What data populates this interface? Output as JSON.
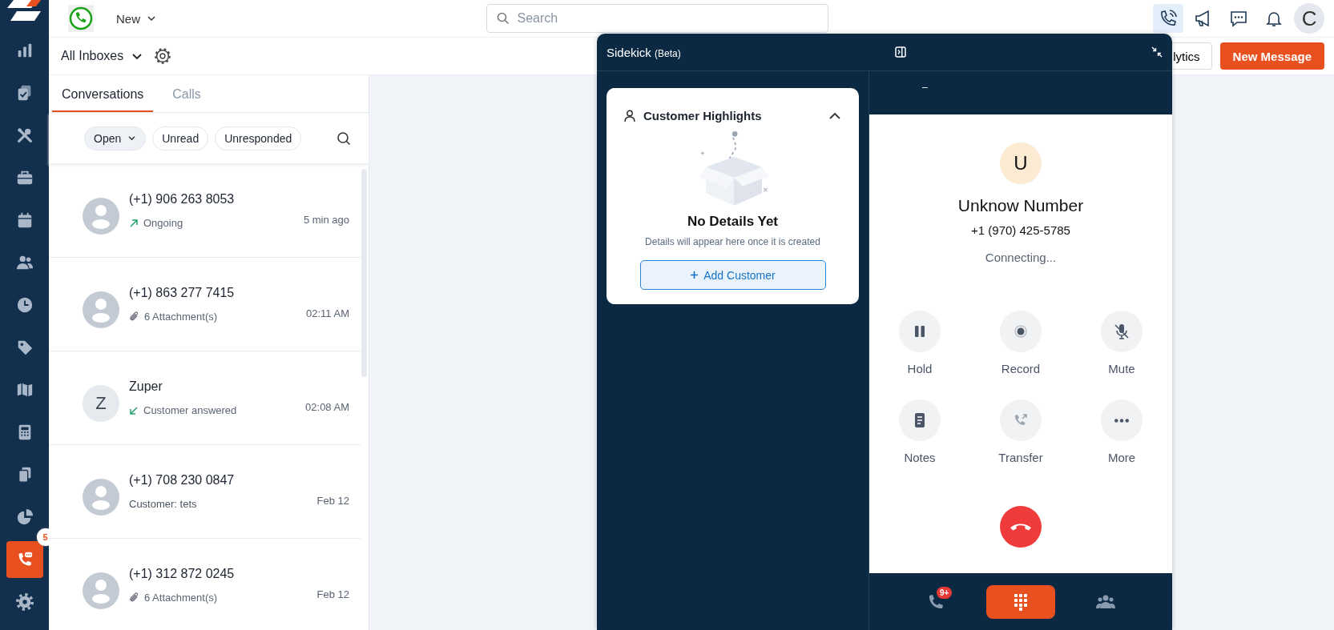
{
  "sidebar": {
    "items": [
      {
        "selected": false
      },
      {
        "selected": false
      },
      {
        "selected": false
      },
      {
        "selected": false
      },
      {
        "selected": false
      },
      {
        "selected": false
      },
      {
        "selected": false
      },
      {
        "selected": false
      },
      {
        "selected": false
      },
      {
        "selected": false
      },
      {
        "selected": false
      },
      {
        "selected": false
      },
      {
        "selected": true,
        "badge": "5"
      },
      {
        "selected": false
      }
    ]
  },
  "top_bar": {
    "new_menu": "New",
    "search": {
      "placeholder": "Search"
    },
    "avatar": "C",
    "phone_selected": true
  },
  "inbox_bar": {
    "inbox": "All Inboxes",
    "analytics_button": "lytics",
    "new_message_button": "New Message"
  },
  "tabs": [
    {
      "label": "Conversations",
      "selected": true
    },
    {
      "label": "Calls",
      "selected": false
    }
  ],
  "filters": [
    {
      "label": "Open",
      "kind": "dropdown"
    },
    {
      "label": "Unread",
      "kind": "chip"
    },
    {
      "label": "Unresponded",
      "kind": "chip"
    }
  ],
  "conversations": [
    {
      "name": "(+1) 906 263 8053",
      "kind": "outgoing",
      "subtitle": "Ongoing",
      "time": "5 min ago"
    },
    {
      "name": "(+1) 863 277 7415",
      "kind": "attachment",
      "subtitle": "6 Attachment(s)",
      "time": "02:11 AM"
    },
    {
      "name": "Zuper",
      "initial": "Z",
      "kind": "incoming",
      "subtitle": "Customer answered",
      "time": "02:08 AM"
    },
    {
      "name": "(+1) 708 230 0847",
      "kind": "text",
      "subtitle": "Customer: tets",
      "time": "Feb 12"
    },
    {
      "name": "(+1) 312 872 0245",
      "kind": "attachment",
      "subtitle": "6 Attachment(s)",
      "time": "Feb 12"
    }
  ],
  "sidekick": {
    "title": "Sidekick",
    "beta": "(Beta)",
    "highlights": {
      "title": "Customer Highlights",
      "expanded": true,
      "empty_title": "No Details Yet",
      "empty_text": "Details will appear here once it is created",
      "add_button": "Add Customer"
    },
    "call": {
      "header_mark": "–",
      "avatar": "U",
      "name": "Unknow Number",
      "number": "+1 (970) 425-5785",
      "status": "Connecting...",
      "actions": [
        {
          "label": "Hold",
          "kind": "hold"
        },
        {
          "label": "Record",
          "kind": "record"
        },
        {
          "label": "Mute",
          "kind": "mute"
        },
        {
          "label": "Notes",
          "kind": "notes"
        },
        {
          "label": "Transfer",
          "kind": "transfer"
        },
        {
          "label": "More",
          "kind": "more"
        }
      ]
    },
    "footer_tabs": [
      {
        "kind": "calls",
        "badge": "9+",
        "selected": false
      },
      {
        "kind": "keypad",
        "selected": true
      },
      {
        "kind": "team",
        "selected": false
      }
    ]
  }
}
